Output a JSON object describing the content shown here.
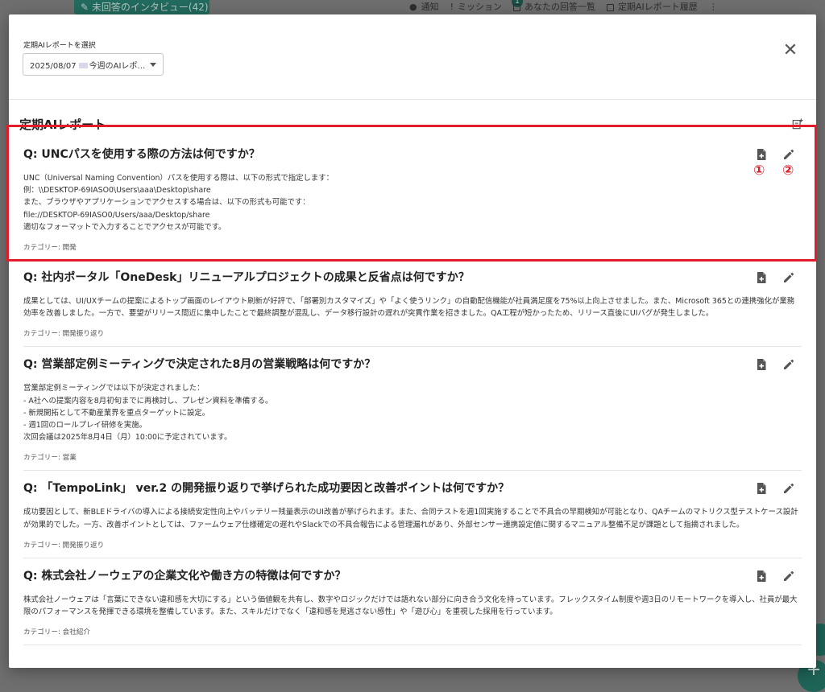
{
  "background": {
    "unanswered_button": "未回答のインタビュー(42)",
    "nav": [
      "通知",
      "ミッション",
      "あなたの回答一覧",
      "定期AIレポート履歴"
    ],
    "notification_count": "1"
  },
  "modal": {
    "select_label": "定期AIレポートを選択",
    "select_value_date": "2025/08/07",
    "select_value_text": "今週のAIレポ…",
    "report_title": "定期AIレポート"
  },
  "annotations": [
    "①",
    "②"
  ],
  "items": [
    {
      "question": "Q: UNCパスを使用する際の方法は何ですか？",
      "answer": "UNC（Universal Naming Convention）パスを使用する際は、以下の形式で指定します：\n例：\\\\DESKTOP-69IASO0\\Users\\aaa\\Desktop\\share\nまた、ブラウザやアプリケーションでアクセスする場合は、以下の形式も可能です：\nfile://DESKTOP-69IASO0/Users/aaa/Desktop/share\n適切なフォーマットで入力することでアクセスが可能です。",
      "category": "カテゴリー: 開発"
    },
    {
      "question": "Q: 社内ポータル「OneDesk」リニューアルプロジェクトの成果と反省点は何ですか？",
      "answer": "成果としては、UI/UXチームの提案によるトップ画面のレイアウト刷新が好評で、「部署別カスタマイズ」や「よく使うリンク」の自動配信機能が社員満足度を75%以上向上させました。また、Microsoft 365との連携強化が業務効率を改善しました。一方で、要望がリリース間近に集中したことで最終調整が混乱し、データ移行設計の遅れが突貫作業を招きました。QA工程が短かったため、リリース直後にUIバグが発生しました。",
      "category": "カテゴリー: 開発振り返り"
    },
    {
      "question": "Q: 営業部定例ミーティングで決定された8月の営業戦略は何ですか？",
      "answer": "営業部定例ミーティングでは以下が決定されました：\n- A社への提案内容を8月初旬までに再検討し、プレゼン資料を準備する。\n- 新規開拓として不動産業界を重点ターゲットに設定。\n- 週1回のロールプレイ研修を実施。\n次回会議は2025年8月4日（月）10:00に予定されています。",
      "category": "カテゴリー: 営業"
    },
    {
      "question": "Q: 「TempoLink」 ver.2 の開発振り返りで挙げられた成功要因と改善ポイントは何ですか？",
      "answer": "成功要因として、新BLEドライバの導入による接続安定性向上やバッテリー残量表示のUI改善が挙げられます。また、合同テストを週1回実施することで不具合の早期検知が可能となり、QAチームのマトリクス型テストケース設計が効果的でした。一方、改善ポイントとしては、ファームウェア仕様確定の遅れやSlackでの不具合報告による管理漏れがあり、外部センサー連携設定値に関するマニュアル整備不足が課題として指摘されました。",
      "category": "カテゴリー: 開発振り返り"
    },
    {
      "question": "Q: 株式会社ノーウェアの企業文化や働き方の特徴は何ですか？",
      "answer": "株式会社ノーウェアは「言葉にできない違和感を大切にする」という価値観を共有し、数字やロジックだけでは語れない部分に向き合う文化を持っています。フレックスタイム制度や週3日のリモートワークを導入し、社員が最大限のパフォーマンスを発揮できる環境を整備しています。また、スキルだけでなく「違和感を見逃さない感性」や「遊び心」を重視した採用を行っています。",
      "category": "カテゴリー: 会社紹介"
    }
  ],
  "colors": {
    "highlight": "#e21c2a",
    "brand_green": "#226b5e"
  }
}
